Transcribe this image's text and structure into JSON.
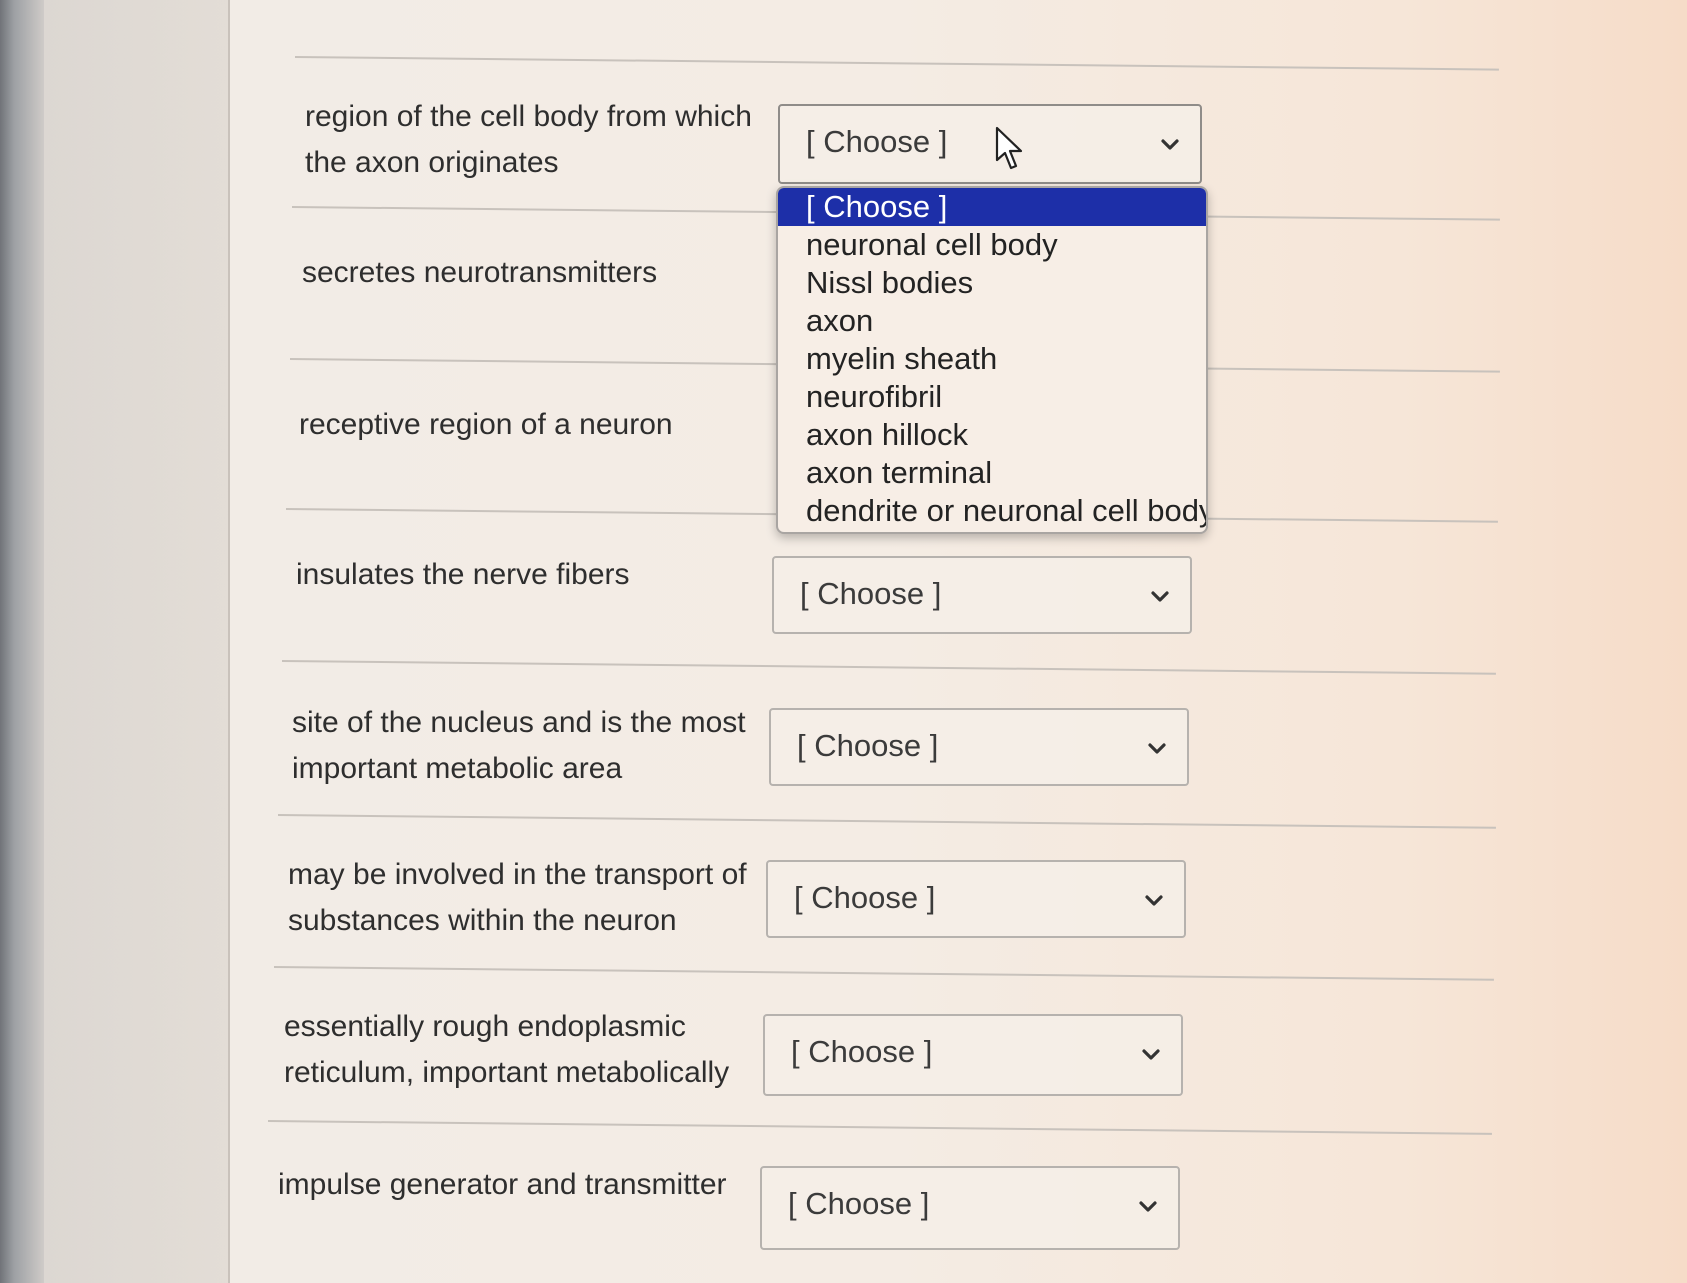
{
  "rows": [
    {
      "prompt_line1": "region of the cell body from which",
      "prompt_line2": "the axon originates",
      "select_value": "[ Choose ]"
    },
    {
      "prompt_line1": "secretes neurotransmitters",
      "prompt_line2": "",
      "select_value": "[ Choose ]"
    },
    {
      "prompt_line1": "receptive region of a neuron",
      "prompt_line2": "",
      "select_value": "[ Choose ]"
    },
    {
      "prompt_line1": "insulates the nerve fibers",
      "prompt_line2": "",
      "select_value": "[ Choose ]"
    },
    {
      "prompt_line1": "site of the nucleus and is the most",
      "prompt_line2": "important metabolic area",
      "select_value": "[ Choose ]"
    },
    {
      "prompt_line1": "may be involved in the transport of",
      "prompt_line2": "substances within the neuron",
      "select_value": "[ Choose ]"
    },
    {
      "prompt_line1": "essentially rough endoplasmic",
      "prompt_line2": "reticulum, important metabolically",
      "select_value": "[ Choose ]"
    },
    {
      "prompt_line1": "impulse generator and transmitter",
      "prompt_line2": "",
      "select_value": "[ Choose ]"
    }
  ],
  "dropdown": {
    "options": [
      "[ Choose ]",
      "neuronal cell body",
      "Nissl bodies",
      "axon",
      "myelin sheath",
      "neurofibril",
      "axon hillock",
      "axon terminal",
      "dendrite or neuronal cell body"
    ],
    "highlight_color": "#1d2fa8"
  },
  "icons": {
    "chevron": "chevron-down-icon",
    "cursor": "mouse-pointer-icon"
  }
}
